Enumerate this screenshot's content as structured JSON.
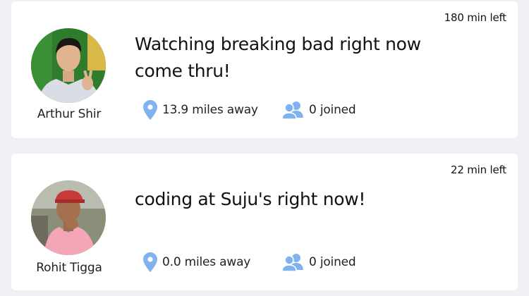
{
  "colors": {
    "background": "#efeff4",
    "card": "#ffffff",
    "icon_blue": "#7fb2ee"
  },
  "posts": [
    {
      "time_left": "180 min left",
      "user_name": "Arthur Shir",
      "text": "Watching breaking bad right now come thru!",
      "distance": "13.9 miles away",
      "joined": "0 joined"
    },
    {
      "time_left": "22 min left",
      "user_name": "Rohit Tigga",
      "text": "coding at Suju's right now!",
      "distance": "0.0 miles away",
      "joined": "0 joined"
    }
  ],
  "icons": {
    "location": "location-pin-icon",
    "people": "people-icon"
  }
}
